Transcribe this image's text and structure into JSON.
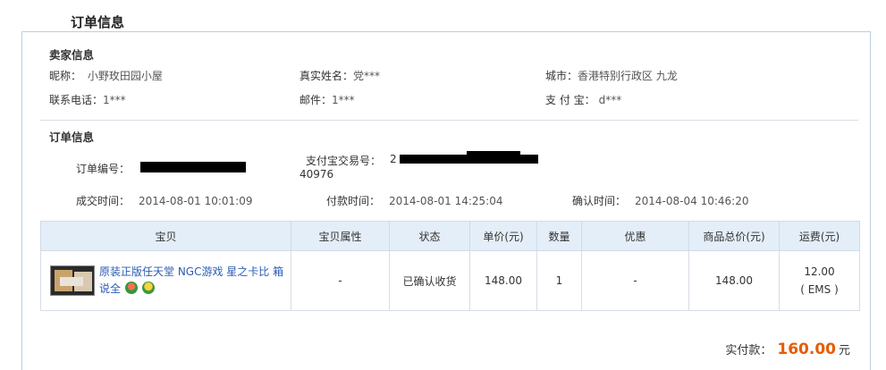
{
  "page_title": "订单信息",
  "seller": {
    "section_title": "卖家信息",
    "nickname_label": "昵称：",
    "nickname": "小野玫田园小屋",
    "realname_label": "真实姓名：",
    "realname": "党***",
    "city_label": "城市：",
    "city": "香港特别行政区 九龙",
    "phone_label": "联系电话：",
    "phone": "1***",
    "email_label": "邮件：",
    "email": "1***",
    "alipay_label": "支 付 宝：",
    "alipay": "d***"
  },
  "order": {
    "section_title": "订单信息",
    "order_no_label": "订单编号：",
    "alipay_trade_label": "支付宝交易号：",
    "alipay_trade_prefix": "2",
    "alipay_trade_suffix": "40976",
    "deal_time_label": "成交时间：",
    "deal_time": "2014-08-01 10:01:09",
    "pay_time_label": "付款时间：",
    "pay_time": "2014-08-01 14:25:04",
    "confirm_time_label": "确认时间：",
    "confirm_time": "2014-08-04 10:46:20"
  },
  "table": {
    "headers": [
      "宝贝",
      "宝贝属性",
      "状态",
      "单价(元)",
      "数量",
      "优惠",
      "商品总价(元)",
      "运费(元)"
    ],
    "row": {
      "product_title": "原装正版任天堂 NGC游戏 星之卡比 箱说全",
      "attr": "-",
      "status": "已确认收货",
      "unit_price": "148.00",
      "quantity": "1",
      "discount": "-",
      "total_price": "148.00",
      "shipping": "12.00",
      "shipping_method": "( EMS )"
    }
  },
  "payment": {
    "label": "实付款：",
    "amount": "160.00",
    "unit": "元"
  },
  "icons": {
    "badge_1": "flower-badge-icon",
    "badge_2": "flower-badge-icon"
  },
  "colors": {
    "link": "#2a5bb3",
    "amount": "#e65c00",
    "header_bg": "#e4eef8",
    "border": "#b9d0e6"
  }
}
